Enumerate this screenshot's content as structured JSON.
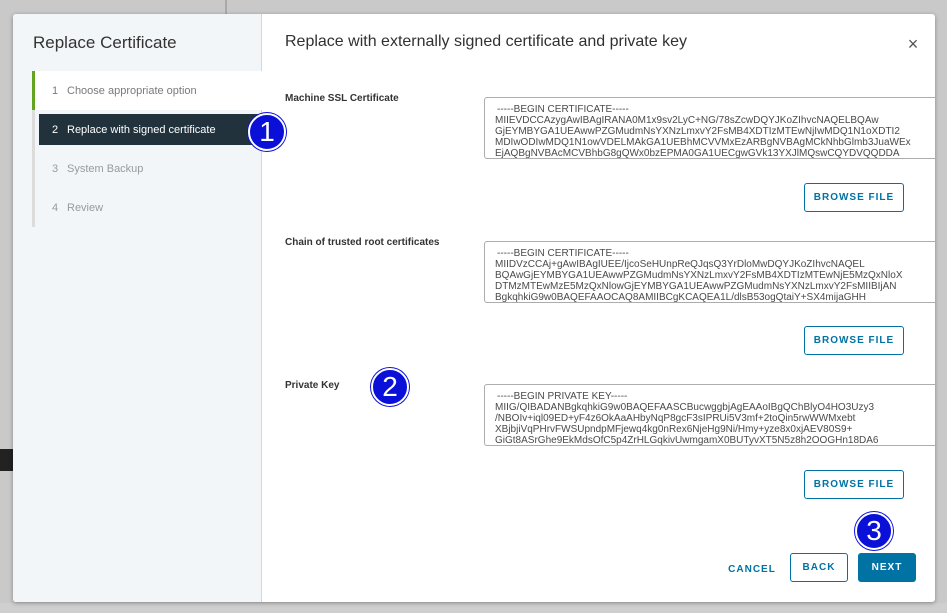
{
  "sidebar": {
    "title": "Replace Certificate",
    "steps": [
      {
        "num": "1",
        "label": "Choose appropriate option"
      },
      {
        "num": "2",
        "label": "Replace with signed certificate"
      },
      {
        "num": "3",
        "label": "System Backup"
      },
      {
        "num": "4",
        "label": "Review"
      }
    ]
  },
  "main": {
    "title": "Replace with externally signed certificate and private key",
    "close_icon": "×",
    "fields": [
      {
        "label": "Machine SSL Certificate",
        "lines": [
          "-----BEGIN CERTIFICATE-----",
          "MIIEVDCCAzygAwIBAgIRANA0M1x9sv2LyC+NG/78sZcwDQYJKoZIhvcNAQELBQAw",
          "GjEYMBYGA1UEAwwPZGMudmNsYXNzLmxvY2FsMB4XDTIzMTEwNjIwMDQ1N1oXDTI2",
          "MDIwODIwMDQ1N1owVDELMAkGA1UEBhMCVVMxEzARBgNVBAgMCkNhbGlmb3JuaWEx",
          "EjAQBgNVBAcMCVBhbG8gQWx0bzEPMA0GA1UECgwGVk13YXJlMQswCQYDVQQDDA"
        ],
        "browse_label": "BROWSE FILE"
      },
      {
        "label": "Chain of trusted root certificates",
        "lines": [
          "-----BEGIN CERTIFICATE-----",
          "MIIDVzCCAj+gAwIBAgIUEE/IjcoSeHUnpReQJqsQ3YrDloMwDQYJKoZIhvcNAQEL",
          "BQAwGjEYMBYGA1UEAwwPZGMudmNsYXNzLmxvY2FsMB4XDTIzMTEwNjE5MzQxNloX",
          "DTMzMTEwMzE5MzQxNlowGjEYMBYGA1UEAwwPZGMudmNsYXNzLmxvY2FsMIIBIjAN",
          "BgkqhkiG9w0BAQEFAAOCAQ8AMIIBCgKCAQEA1L/dlsB53ogQtaiY+SX4mijaGHH"
        ],
        "browse_label": "BROWSE FILE"
      },
      {
        "label": "Private Key",
        "lines": [
          "-----BEGIN PRIVATE KEY-----",
          "MIIG/QIBADANBgkqhkiG9w0BAQEFAASCBucwggbjAgEAAoIBgQChBlyO4HO3Uzy3",
          "/NBOIv+iql09ED+yF4z6OkAaAHbyNqP8gcF3sIPRUi5V3mf+2toQin5rwWWMxebt",
          "XBjbjiVqPHrvFWSUpndpMFjewq4kg0nRex6NjeHg9Ni/Hmy+yze8x0xjAEV80S9+",
          "GiGt8ASrGhe9EkMdsOfC5p4ZrHLGqkivUwmgamX0BUTyvXT5N5z8h2OOGHn18DA6"
        ],
        "browse_label": "BROWSE FILE"
      }
    ]
  },
  "footer": {
    "cancel_label": "CANCEL",
    "back_label": "BACK",
    "next_label": "NEXT"
  },
  "callouts": [
    "1",
    "2",
    "3"
  ],
  "colors": {
    "primary": "#0072a3",
    "active_step_bg": "#22323d",
    "done_step_bar": "#62a420",
    "callout": "#0a10d8"
  }
}
